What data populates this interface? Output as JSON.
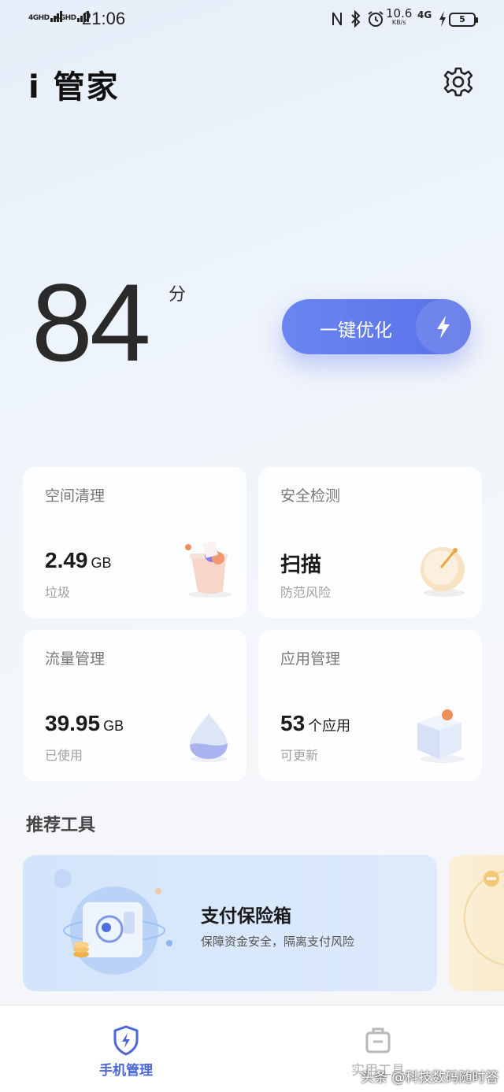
{
  "status_bar": {
    "sim1": "4GHD",
    "sim2": "4GHD",
    "time": "21:06",
    "network_speed": "10.6",
    "network_speed_unit": "KB/s",
    "network_type": "4G",
    "battery_level": "5"
  },
  "header": {
    "title": "i 管家",
    "settings_icon": "gear-icon"
  },
  "score": {
    "value": "84",
    "unit": "分"
  },
  "optimize_button": {
    "label": "一键优化",
    "icon": "lightning-icon",
    "color": "#5c74ea"
  },
  "cards": [
    {
      "title": "空间清理",
      "value": "2.49",
      "unit": "GB",
      "sub": "垃圾",
      "icon": "trash-bin-icon"
    },
    {
      "title": "安全检测",
      "value": "扫描",
      "unit": "",
      "sub": "防范风险",
      "icon": "radar-scan-icon"
    },
    {
      "title": "流量管理",
      "value": "39.95",
      "unit": "GB",
      "sub": "已使用",
      "icon": "water-drop-icon"
    },
    {
      "title": "应用管理",
      "value": "53",
      "unit": "个应用",
      "sub": "可更新",
      "icon": "app-cube-icon"
    }
  ],
  "recommended": {
    "title": "推荐工具",
    "tools": [
      {
        "title": "支付保险箱",
        "desc": "保障资金安全，隔离支付风险",
        "icon": "safe-box-icon"
      }
    ]
  },
  "bottom_nav": {
    "items": [
      {
        "label": "手机管理",
        "icon": "shield-lightning-icon",
        "active": true
      },
      {
        "label": "实用工具",
        "icon": "toolbox-icon",
        "active": false
      }
    ],
    "active_color": "#4a66d8"
  },
  "watermark": "头条 @科技数码随时答"
}
